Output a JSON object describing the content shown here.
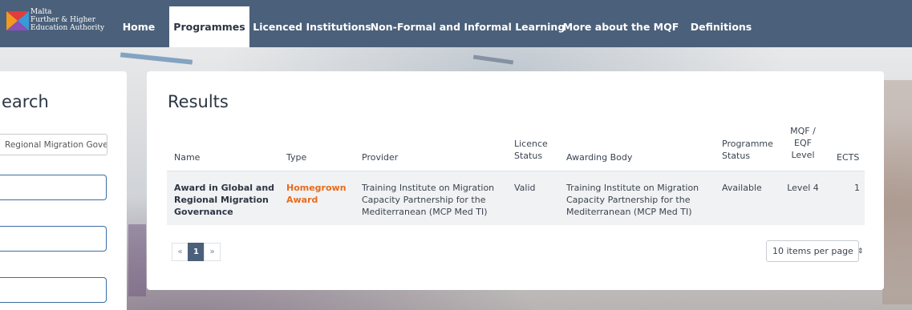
{
  "nav": {
    "logo_lines": [
      "Malta",
      "Further & Higher",
      "Education Authority"
    ],
    "items": [
      {
        "label": "Home"
      },
      {
        "label": "Programmes"
      },
      {
        "label": "Licenced Institutions"
      },
      {
        "label": "Non-Formal and Informal Learning"
      },
      {
        "label": "More about the MQF"
      },
      {
        "label": "Definitions"
      }
    ],
    "active": "Programmes"
  },
  "search": {
    "title": "Search",
    "title_visible": "earch",
    "query_value": "Regional Migration Gove"
  },
  "results": {
    "title": "Results",
    "columns": {
      "name": "Name",
      "type": "Type",
      "provider": "Provider",
      "licence_status_1": "Licence",
      "licence_status_2": "Status",
      "awarding_body": "Awarding Body",
      "programme_status_1": "Programme",
      "programme_status_2": "Status",
      "level_1": "MQF /",
      "level_2": "EQF",
      "level_3": "Level",
      "ects": "ECTS"
    },
    "rows": [
      {
        "name": [
          "Award in Global and",
          "Regional Migration",
          "Governance"
        ],
        "type": [
          "Homegrown",
          "Award"
        ],
        "provider": [
          "Training Institute on Migration",
          "Capacity Partnership for the",
          "Mediterranean (MCP Med TI)"
        ],
        "licence_status": "Valid",
        "awarding_body": [
          "Training Institute on Migration",
          "Capacity Partnership for the",
          "Mediterranean (MCP Med TI)"
        ],
        "programme_status": "Available",
        "level": "Level 4",
        "ects": "1"
      }
    ],
    "pagination": {
      "prev": "«",
      "current": "1",
      "next": "»"
    },
    "per_page": "10 items per page",
    "per_page_caret": "⇕"
  },
  "colors": {
    "nav_bg": "#4b607a",
    "accent_orange": "#e86b1c",
    "field_border": "#3a6ea5"
  }
}
